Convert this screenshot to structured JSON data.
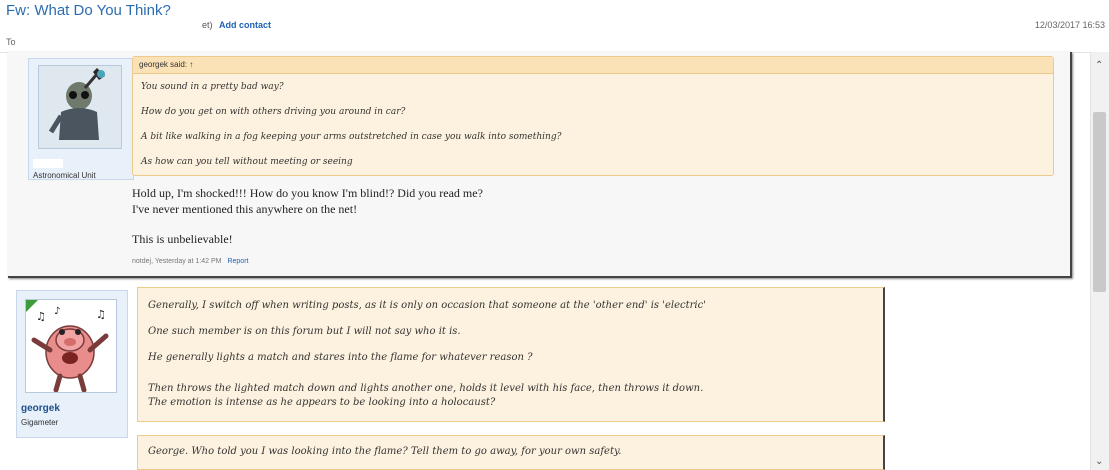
{
  "mail": {
    "subject": "Fw: What Do You Think?",
    "sender_fragment": "et)",
    "add_contact": "Add contact",
    "date": "12/03/2017 16:53",
    "to_label": "To"
  },
  "post1": {
    "user_title": "Astronomical Unit",
    "quote_author": "georgek said: ↑",
    "quote_lines": [
      "You sound in a pretty bad way?",
      "How do you get on with others driving you around in car?",
      "A bit like walking in a fog keeping your arms outstretched in case you walk into something?",
      "As how can you tell without meeting or seeing"
    ],
    "message_lines": [
      "Hold up, I'm shocked!!! How do you know I'm blind!? Did you read me?",
      "I've never mentioned this anywhere on the net!",
      "This is unbelievable!"
    ],
    "meta": "notdej, Yesterday at 1:42 PM",
    "report_label": "Report"
  },
  "post2": {
    "username": "georgek",
    "user_title": "Gigameter",
    "quote_lines": [
      "Generally, I switch off when writing posts, as it is only on occasion that someone at the 'other end' is 'electric'",
      "One such member is on this forum but I will not say who it is.",
      "He generally lights a match and stares into the flame for whatever reason ?",
      "Then throws the lighted match down and lights another one, holds it level with his face, then throws it down.",
      "The emotion is intense as he appears to be looking into a holocaust?"
    ],
    "reply_line": "George. Who told you I was looking into the flame? Tell them to go away, for your own safety."
  },
  "icons": {
    "scroll_up": "chevron-up-icon",
    "scroll_down": "chevron-down-icon"
  }
}
